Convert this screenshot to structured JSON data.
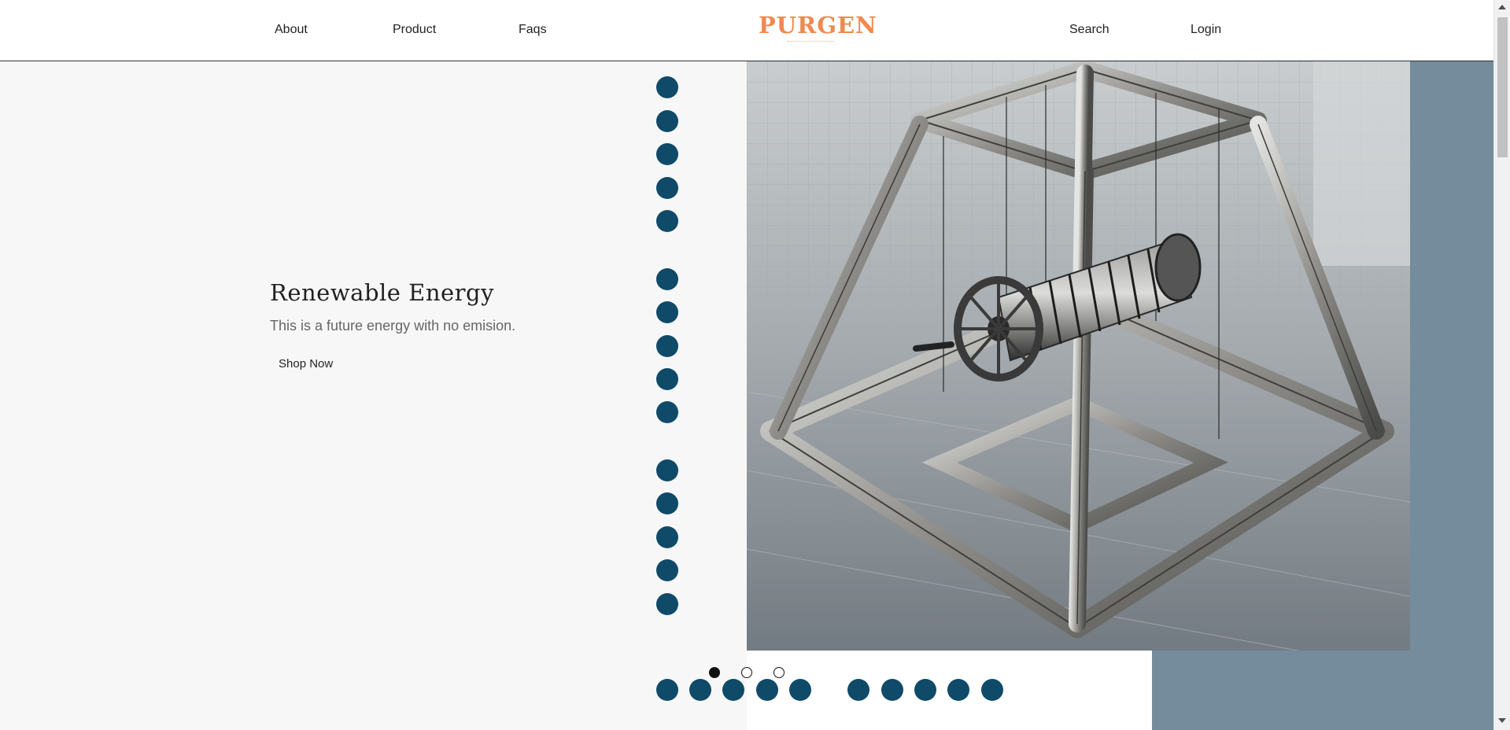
{
  "header": {
    "nav_left": [
      {
        "label": "About"
      },
      {
        "label": "Product"
      },
      {
        "label": "Faqs"
      }
    ],
    "logo_text": "PURGEN",
    "nav_right": [
      {
        "label": "Search"
      },
      {
        "label": "Login"
      }
    ]
  },
  "hero": {
    "title": "Renewable Energy",
    "subtitle": "This is a future energy with no emision.",
    "cta_label": "Shop Now",
    "image_alt": "steel truss frame with cable winch drum"
  },
  "carousel": {
    "slide_count": 3,
    "active_index": 0
  },
  "colors": {
    "accent_logo": "#f0894f",
    "dot": "#0f4a69",
    "slate": "#748c9c",
    "hero_bg": "#f7f7f7"
  },
  "icons": {
    "scroll_up": "scroll-up-arrow-icon",
    "scroll_down": "scroll-down-arrow-icon"
  }
}
